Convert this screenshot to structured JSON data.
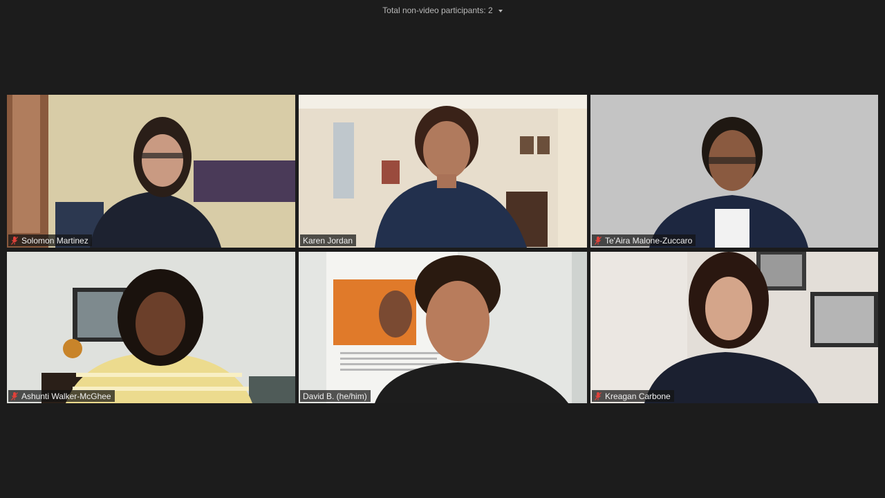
{
  "header": {
    "participants_text": "Total non-video participants: 2"
  },
  "participants": [
    {
      "name": "Solomon Martinez",
      "muted": true,
      "active": false
    },
    {
      "name": "Karen Jordan",
      "muted": false,
      "active": true
    },
    {
      "name": "Te'Aira Malone-Zuccaro",
      "muted": true,
      "active": false
    },
    {
      "name": "Ashunti Walker-McGhee",
      "muted": true,
      "active": false
    },
    {
      "name": "David B. (he/him)",
      "muted": false,
      "active": false
    },
    {
      "name": "Kreagan Carbone",
      "muted": true,
      "active": false
    }
  ],
  "colors": {
    "background": "#1c1c1c",
    "active_speaker_border": "#a8d43a",
    "muted_icon": "#e0413a"
  }
}
